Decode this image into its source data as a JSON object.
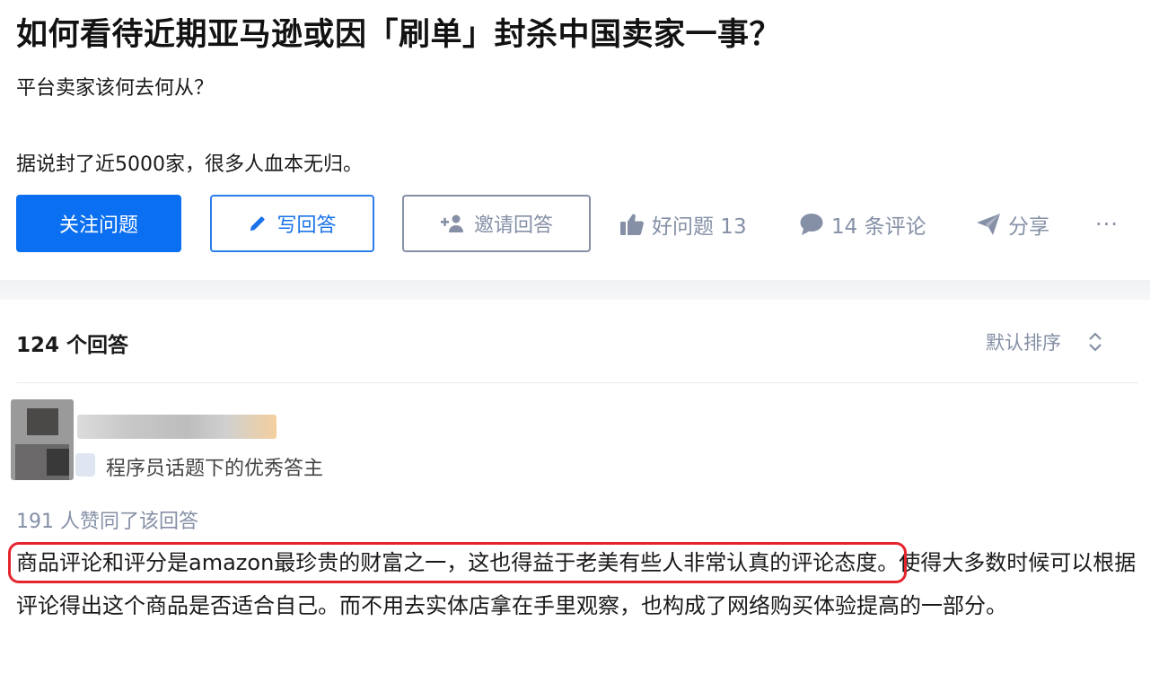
{
  "question": {
    "title": "如何看待近期亚马逊或因「刷单」封杀中国卖家一事？",
    "subtitle": "平台卖家该何去何从？",
    "detail": "据说封了近5000家，很多人血本无归。"
  },
  "actions": {
    "follow_label": "关注问题",
    "write_label": "写回答",
    "invite_label": "邀请回答",
    "good_question_label": "好问题 13",
    "comments_label": "14 条评论",
    "share_label": "分享",
    "more_label": "···"
  },
  "answers": {
    "count_label": "124 个回答",
    "sort_label": "默认排序"
  },
  "answer": {
    "author_badge": "程序员话题下的优秀答主",
    "votes_label": "191 人赞同了该回答",
    "text_highlighted": "商品评论和评分是amazon最珍贵的财富之一，这也得益于老美有些人非常认真的评论态度。",
    "text_rest": "使得大多数时候可以根据评论得出这个商品是否适合自己。而不用去实体店拿在手里观察，也构成了网络购买体验提高的一部分。"
  },
  "colors": {
    "primary": "#0a6ff0",
    "muted": "#8590a6",
    "highlight_box": "#e5252d"
  },
  "icons": [
    "pencil-icon",
    "add-user-icon",
    "thumb-up-icon",
    "comment-icon",
    "share-icon",
    "sort-chevrons-icon"
  ]
}
